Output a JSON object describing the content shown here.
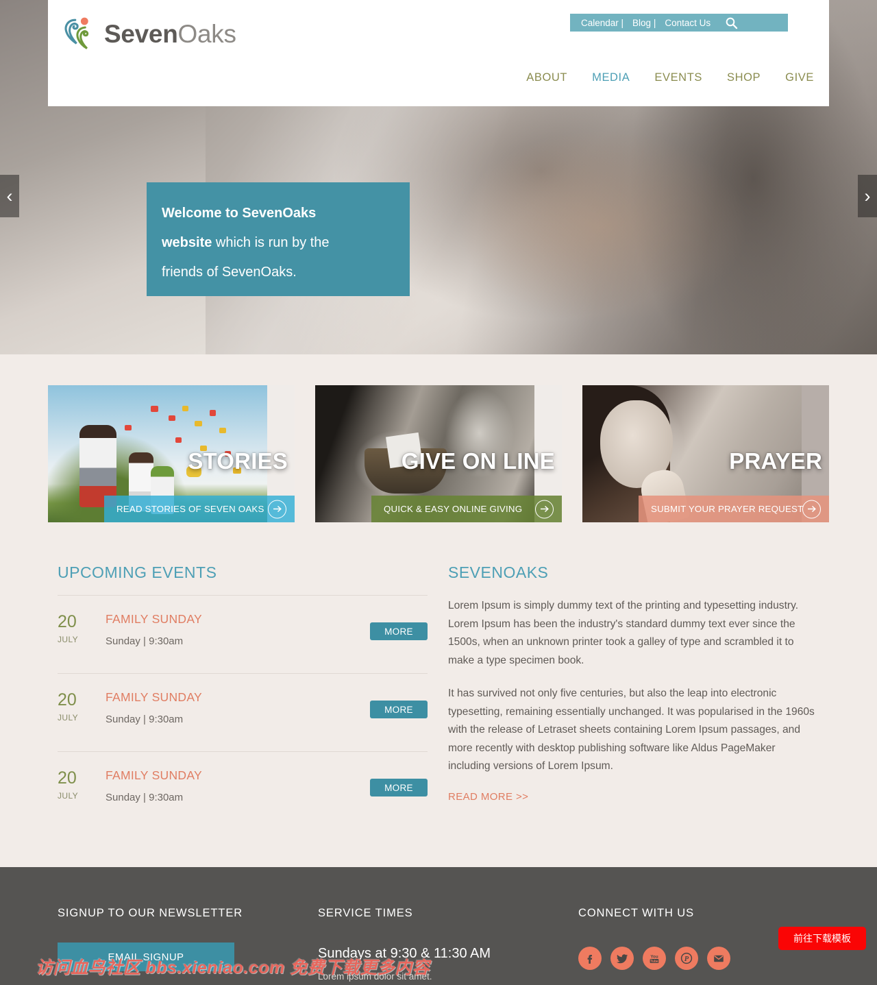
{
  "site": {
    "logo_bold": "Seven",
    "logo_light": "Oaks",
    "logo_icon": "seven-oaks-logo-icon"
  },
  "utility_nav": {
    "items": [
      {
        "label": "Calendar |"
      },
      {
        "label": "Blog |"
      },
      {
        "label": "Contact Us"
      }
    ],
    "search_icon": "search-icon",
    "background": "#72b3c0"
  },
  "main_nav": {
    "items": [
      {
        "label": "ABOUT",
        "active": false
      },
      {
        "label": "MEDIA",
        "active": true
      },
      {
        "label": "EVENTS",
        "active": false
      },
      {
        "label": "SHOP",
        "active": false
      },
      {
        "label": "GIVE",
        "active": false
      }
    ],
    "color": "#8a8c4f",
    "active_color": "#4d9fb5"
  },
  "hero": {
    "caption_line1_bold": "Welcome to SevenOaks",
    "caption_line2_bold": "website",
    "caption_line2_rest": " which is run by the",
    "caption_line3": "friends of SevenOaks.",
    "caption_bg": "#4492a5",
    "prev_arrow": "‹",
    "next_arrow": "›"
  },
  "cards": [
    {
      "title": "STORIES",
      "cta": "READ STORIES OF SEVEN OAKS",
      "accent": "#32afd6",
      "arrow": "→",
      "image_name": "kids-throwing-confetti-photo"
    },
    {
      "title": "GIVE ON LINE",
      "cta": "QUICK & EASY ONLINE GIVING",
      "accent": "#688336",
      "arrow": "→",
      "image_name": "offering-basket-photo"
    },
    {
      "title": "PRAYER",
      "cta": "SUBMIT YOUR PRAYER REQUEST",
      "accent": "#e5937d",
      "arrow": "→",
      "image_name": "praying-girl-photo"
    }
  ],
  "events": {
    "heading": "UPCOMING EVENTS",
    "items": [
      {
        "day": "20",
        "month": "JULY",
        "title": "FAMILY SUNDAY",
        "detail": "Sunday | 9:30am",
        "button": "MORE"
      },
      {
        "day": "20",
        "month": "JULY",
        "title": "FAMILY SUNDAY",
        "detail": "Sunday | 9:30am",
        "button": "MORE"
      },
      {
        "day": "20",
        "month": "JULY",
        "title": "FAMILY SUNDAY",
        "detail": "Sunday | 9:30am",
        "button": "MORE"
      }
    ]
  },
  "about": {
    "heading": "SEVENOAKS",
    "paragraph1": "Lorem Ipsum is simply dummy text of the printing and typesetting industry. Lorem Ipsum has been the industry's standard dummy text ever since the 1500s, when an unknown printer took a galley of type and scrambled it to make a type specimen book.",
    "paragraph2": "It has survived not only five centuries, but also the leap into electronic typesetting, remaining essentially unchanged. It was popularised in the 1960s with the release of Letraset sheets containing Lorem Ipsum passages, and more recently with desktop publishing software like Aldus PageMaker including versions of Lorem Ipsum.",
    "read_more": "READ MORE >>"
  },
  "footer": {
    "newsletter": {
      "title": "SIGNUP TO OUR NEWSLETTER",
      "button": "EMAIL SIGNUP"
    },
    "service_times": {
      "title": "SERVICE TIMES",
      "main": "Sundays at 9:30 & 11:30 AM",
      "sub": "Lorem ipsum dolor sit amet."
    },
    "connect": {
      "title": "CONNECT WITH US",
      "socials": [
        {
          "name": "facebook-icon"
        },
        {
          "name": "twitter-icon"
        },
        {
          "name": "youtube-icon"
        },
        {
          "name": "paypal-icon"
        },
        {
          "name": "email-icon"
        }
      ],
      "color": "#ef7b60"
    },
    "background": "#555452"
  },
  "overlay": {
    "download_button": "前往下载模板",
    "download_color": "#fa0505",
    "watermark": "访问血鸟社区 bbs.xieniao.com 免费下载更多内容"
  }
}
